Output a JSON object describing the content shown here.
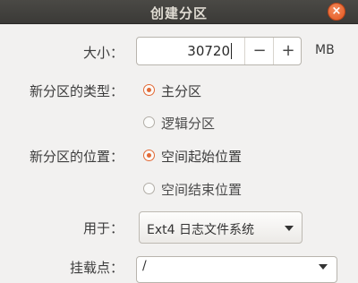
{
  "window": {
    "title": "创建分区",
    "close_glyph": "×"
  },
  "size": {
    "label": "大小：",
    "value": "30720",
    "unit": "MB",
    "minus": "−",
    "plus": "+"
  },
  "type": {
    "label": "新分区的类型：",
    "options": [
      {
        "label": "主分区",
        "checked": true
      },
      {
        "label": "逻辑分区",
        "checked": false
      }
    ]
  },
  "location": {
    "label": "新分区的位置：",
    "options": [
      {
        "label": "空间起始位置",
        "checked": true
      },
      {
        "label": "空间结束位置",
        "checked": false
      }
    ]
  },
  "use_as": {
    "label": "用于：",
    "selected": "Ext4 日志文件系统"
  },
  "mount_point": {
    "label": "挂载点：",
    "value": "/"
  },
  "colors": {
    "accent": "#e26a36",
    "titlebar": "#3b3a37",
    "background": "#f2f1f0"
  }
}
